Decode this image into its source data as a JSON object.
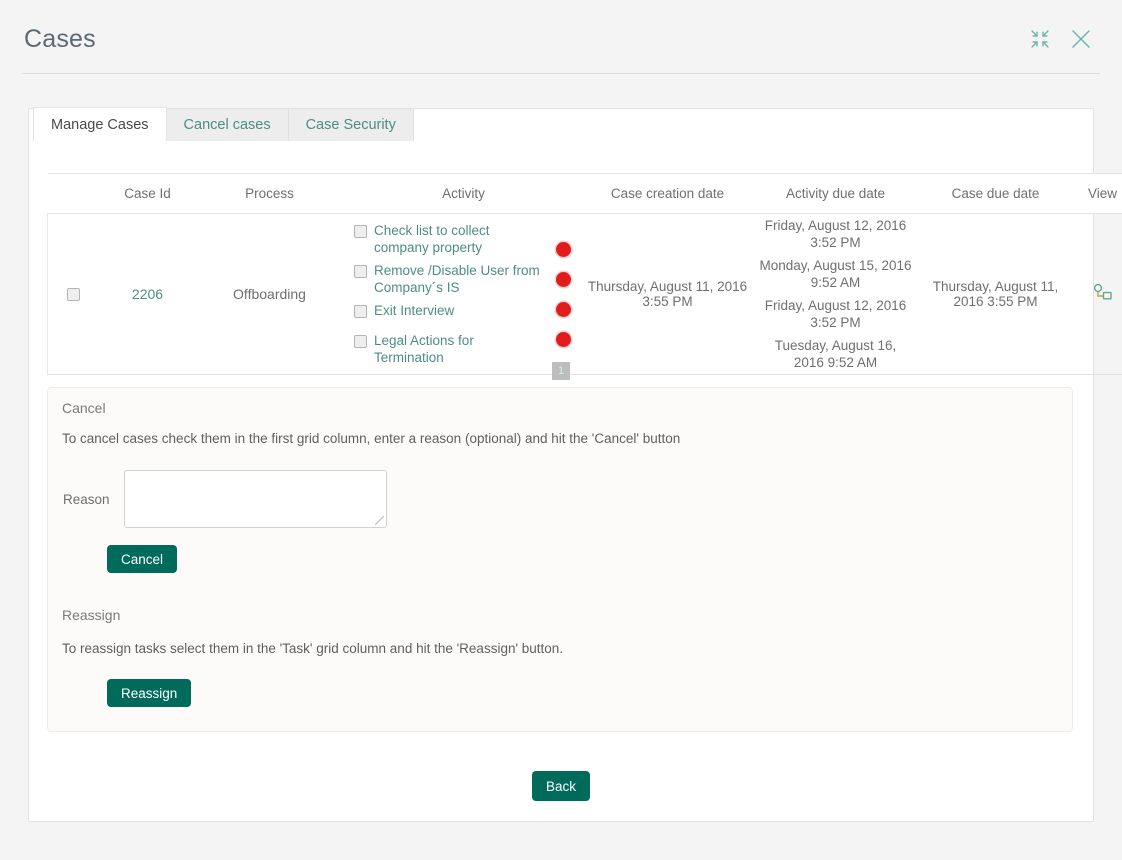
{
  "header": {
    "title": "Cases",
    "actions": [
      {
        "name": "collapse-icon",
        "label": "Collapse"
      },
      {
        "name": "close-icon",
        "label": "Close"
      }
    ]
  },
  "tabs": [
    {
      "label": "Manage Cases",
      "active": true
    },
    {
      "label": "Cancel cases",
      "active": false
    },
    {
      "label": "Case Security",
      "active": false
    }
  ],
  "grid": {
    "columns": [
      "",
      "Case Id",
      "Process",
      "Activity",
      "Case creation date",
      "Activity due date",
      "Case due date",
      "View"
    ],
    "rows": [
      {
        "selected": false,
        "case_id": "2206",
        "process": "Offboarding",
        "activities": [
          {
            "label": "Check list to collect company property",
            "checked": false,
            "status": "red",
            "due": "Friday, August 12, 2016 3:52 PM"
          },
          {
            "label": "Remove /Disable User from Company´s IS",
            "checked": false,
            "status": "red",
            "due": "Monday, August 15, 2016 9:52 AM"
          },
          {
            "label": "Exit Interview",
            "checked": false,
            "status": "red",
            "due": "Friday, August 12, 2016 3:52 PM"
          },
          {
            "label": "Legal Actions for Termination",
            "checked": false,
            "status": "red",
            "due": "Tuesday, August 16, 2016 9:52 AM"
          }
        ],
        "case_creation_date": "Thursday, August 11, 2016 3:55 PM",
        "case_due_date": "Thursday, August 11, 2016 3:55 PM",
        "view_icon": "process-diagram-icon"
      }
    ],
    "pager": {
      "current": "1"
    }
  },
  "cancel_panel": {
    "heading": "Cancel",
    "description": "To cancel cases check them in the first grid column, enter a reason (optional) and hit the 'Cancel' button",
    "reason_label": "Reason",
    "reason_value": "",
    "reason_placeholder": "",
    "cancel_button": "Cancel"
  },
  "reassign_panel": {
    "heading": "Reassign",
    "description": "To reassign tasks select them in the 'Task' grid column and hit the 'Reassign' button.",
    "reassign_button": "Reassign"
  },
  "footer": {
    "back_button": "Back"
  },
  "colors": {
    "accent_button": "#006b5b",
    "link_teal": "#4d8d86",
    "status_red": "#e11c1c",
    "page_bg": "#f4f4f4",
    "panel_bg": "#fdfbfa",
    "title_text": "#5b6a72"
  }
}
